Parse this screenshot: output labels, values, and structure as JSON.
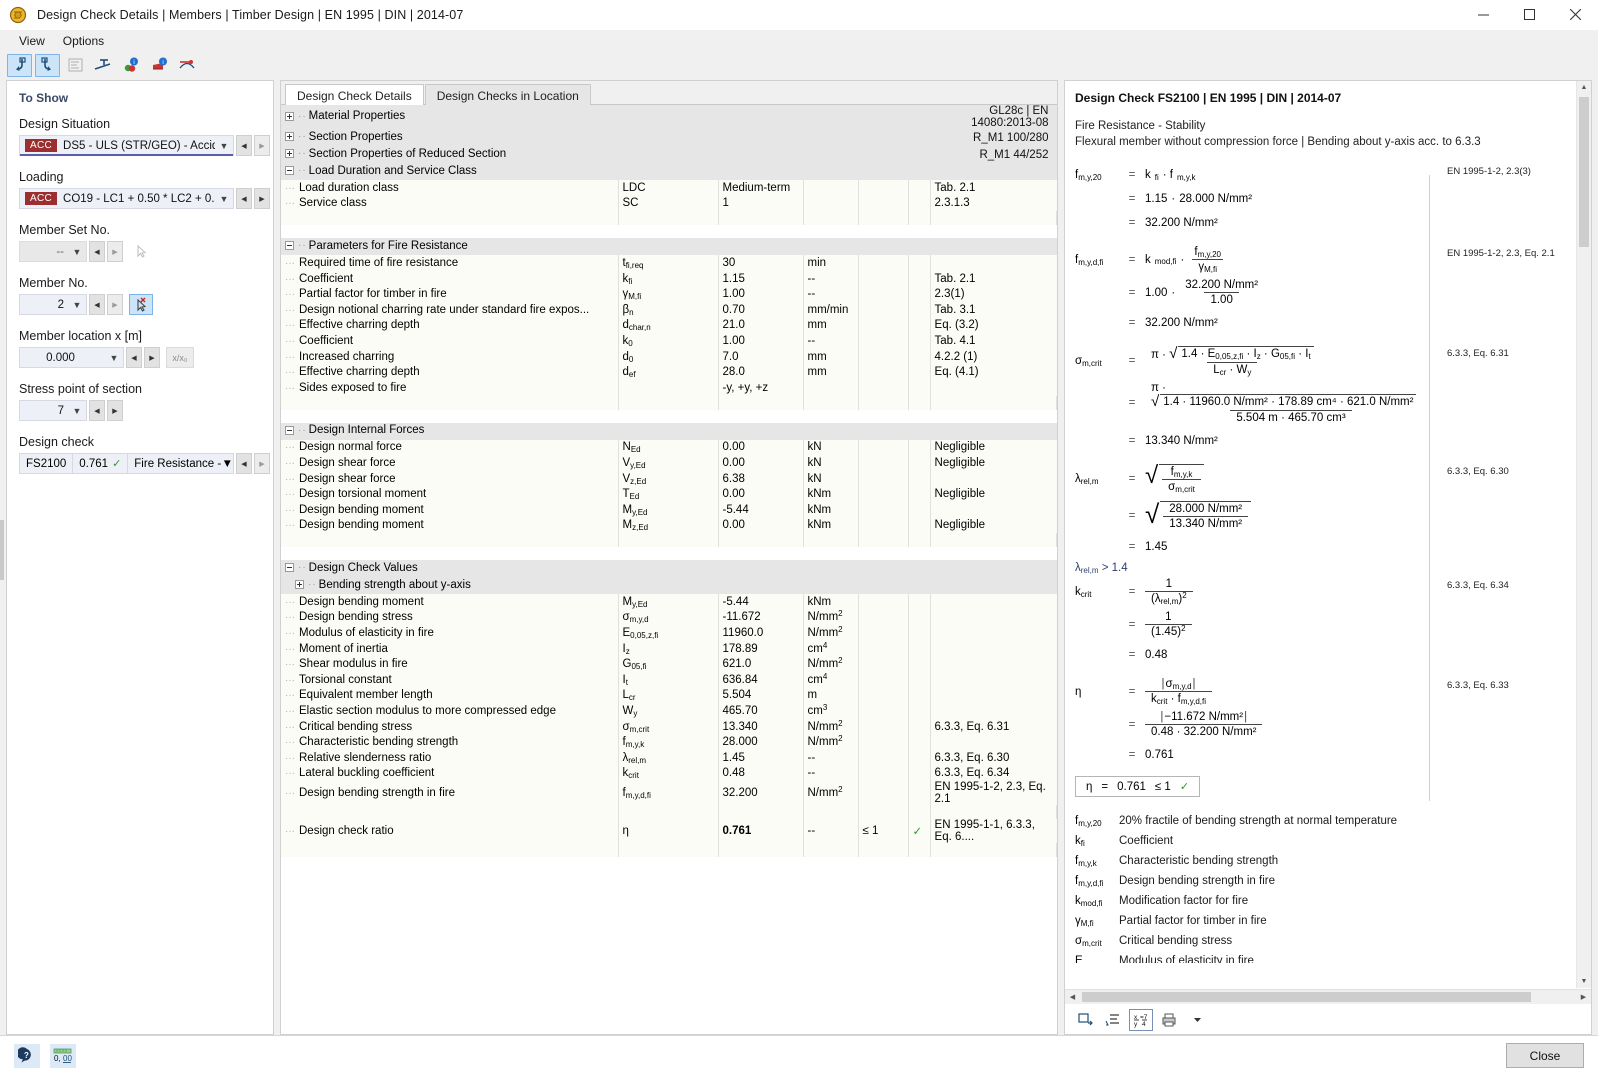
{
  "window": {
    "title": "Design Check Details | Members | Timber Design | EN 1995 | DIN | 2014-07",
    "minimize": "─",
    "maximize": "☐",
    "close": "✕"
  },
  "menubar": {
    "items": [
      "View",
      "Options"
    ]
  },
  "toolbar": {
    "buttons": [
      "navigate-back-icon",
      "navigate-forward-icon",
      "list-view-icon",
      "member-axis-icon",
      "info-green-icon",
      "info-blue-icon",
      "diagram-icon"
    ]
  },
  "left_panel": {
    "heading": "To Show",
    "design_situation": {
      "label": "Design Situation",
      "tag": "ACC",
      "value": "DS5 - ULS (STR/GEO) - Accident..."
    },
    "loading": {
      "label": "Loading",
      "tag": "ACC",
      "value": "CO19 - LC1 + 0.50 * LC2 + 0.50 ..."
    },
    "member_set_no": {
      "label": "Member Set No.",
      "value": "--"
    },
    "member_no": {
      "label": "Member No.",
      "value": "2"
    },
    "member_location": {
      "label": "Member location x [m]",
      "value": "0.000",
      "ratio_button": "x/x₀"
    },
    "stress_point": {
      "label": "Stress point of section",
      "value": "7"
    },
    "design_check": {
      "label": "Design check",
      "id": "FS2100",
      "ratio": "0.761",
      "name": "Fire Resistance - ..."
    }
  },
  "center_panel": {
    "tabs": [
      {
        "label": "Design Check Details",
        "active": true
      },
      {
        "label": "Design Checks in Location",
        "active": false
      }
    ],
    "collapsed_groups": [
      {
        "name": "Material Properties",
        "value": "GL28c | EN 14080:2013-08"
      },
      {
        "name": "Section Properties",
        "value": "R_M1 100/280"
      },
      {
        "name": "Section Properties of Reduced Section",
        "value": "R_M1 44/252"
      }
    ],
    "groups": [
      {
        "name": "Load Duration and Service Class",
        "rows": [
          {
            "name": "Load duration class",
            "symbol": "LDC",
            "value": "Medium-term",
            "value_align": "left",
            "unit": "",
            "limit": "",
            "ok": "",
            "ref": "Tab. 2.1"
          },
          {
            "name": "Service class",
            "symbol": "SC",
            "value": "1",
            "value_align": "left",
            "unit": "",
            "limit": "",
            "ok": "",
            "ref": "2.3.1.3"
          }
        ]
      },
      {
        "name": "Parameters for Fire Resistance",
        "rows": [
          {
            "name": "Required time of fire resistance",
            "symbol": "t|fi,req",
            "value": "30",
            "unit": "min",
            "limit": "",
            "ok": "",
            "ref": ""
          },
          {
            "name": "Coefficient",
            "symbol": "k|fi",
            "value": "1.15",
            "unit": "--",
            "limit": "",
            "ok": "",
            "ref": "Tab. 2.1"
          },
          {
            "name": "Partial factor for timber in fire",
            "symbol": "γ|M,fi",
            "value": "1.00",
            "unit": "--",
            "limit": "",
            "ok": "",
            "ref": "2.3(1)"
          },
          {
            "name": "Design notional charring rate under standard fire expos...",
            "symbol": "β|n",
            "value": "0.70",
            "unit": "mm/min",
            "limit": "",
            "ok": "",
            "ref": "Tab. 3.1"
          },
          {
            "name": "Effective charring depth",
            "symbol": "d|char,n",
            "value": "21.0",
            "unit": "mm",
            "limit": "",
            "ok": "",
            "ref": "Eq. (3.2)"
          },
          {
            "name": "Coefficient",
            "symbol": "k|0",
            "value": "1.00",
            "unit": "--",
            "limit": "",
            "ok": "",
            "ref": "Tab. 4.1"
          },
          {
            "name": "Increased charring",
            "symbol": "d|0",
            "value": "7.0",
            "unit": "mm",
            "limit": "",
            "ok": "",
            "ref": "4.2.2 (1)"
          },
          {
            "name": "Effective charring depth",
            "symbol": "d|ef",
            "value": "28.0",
            "unit": "mm",
            "limit": "",
            "ok": "",
            "ref": "Eq. (4.1)"
          },
          {
            "name": "Sides exposed to fire",
            "symbol": "",
            "value": "-y, +y, +z",
            "value_align": "left",
            "unit": "",
            "limit": "",
            "ok": "",
            "ref": ""
          }
        ]
      },
      {
        "name": "Design Internal Forces",
        "rows": [
          {
            "name": "Design normal force",
            "symbol": "N|Ed",
            "value": "0.00",
            "unit": "kN",
            "limit": "",
            "ok": "",
            "ref": "Negligible"
          },
          {
            "name": "Design shear force",
            "symbol": "V|y,Ed",
            "value": "0.00",
            "unit": "kN",
            "limit": "",
            "ok": "",
            "ref": "Negligible"
          },
          {
            "name": "Design shear force",
            "symbol": "V|z,Ed",
            "value": "6.38",
            "unit": "kN",
            "limit": "",
            "ok": "",
            "ref": ""
          },
          {
            "name": "Design torsional moment",
            "symbol": "T|Ed",
            "value": "0.00",
            "unit": "kNm",
            "limit": "",
            "ok": "",
            "ref": "Negligible"
          },
          {
            "name": "Design bending moment",
            "symbol": "M|y,Ed",
            "value": "-5.44",
            "unit": "kNm",
            "limit": "",
            "ok": "",
            "ref": ""
          },
          {
            "name": "Design bending moment",
            "symbol": "M|z,Ed",
            "value": "0.00",
            "unit": "kNm",
            "limit": "",
            "ok": "",
            "ref": "Negligible"
          }
        ]
      },
      {
        "name": "Design Check Values",
        "subgroup": "Bending strength about y-axis",
        "rows": [
          {
            "name": "Design bending moment",
            "symbol": "M|y,Ed",
            "value": "-5.44",
            "unit": "kNm",
            "limit": "",
            "ok": "",
            "ref": ""
          },
          {
            "name": "Design bending stress",
            "symbol": "σ|m,y,d",
            "value": "-11.672",
            "unit": "N/mm^2",
            "limit": "",
            "ok": "",
            "ref": ""
          },
          {
            "name": "Modulus of elasticity in fire",
            "symbol": "E|0,05,z,fi",
            "value": "11960.0",
            "unit": "N/mm^2",
            "limit": "",
            "ok": "",
            "ref": ""
          },
          {
            "name": "Moment of inertia",
            "symbol": "I|z",
            "value": "178.89",
            "unit": "cm^4",
            "limit": "",
            "ok": "",
            "ref": ""
          },
          {
            "name": "Shear modulus in fire",
            "symbol": "G|05,fi",
            "value": "621.0",
            "unit": "N/mm^2",
            "limit": "",
            "ok": "",
            "ref": ""
          },
          {
            "name": "Torsional constant",
            "symbol": "I|t",
            "value": "636.84",
            "unit": "cm^4",
            "limit": "",
            "ok": "",
            "ref": ""
          },
          {
            "name": "Equivalent member length",
            "symbol": "L|cr",
            "value": "5.504",
            "unit": "m",
            "limit": "",
            "ok": "",
            "ref": ""
          },
          {
            "name": "Elastic section modulus to more compressed edge",
            "symbol": "W|y",
            "value": "465.70",
            "unit": "cm^3",
            "limit": "",
            "ok": "",
            "ref": ""
          },
          {
            "name": "Critical bending stress",
            "symbol": "σ|m,crit",
            "value": "13.340",
            "unit": "N/mm^2",
            "limit": "",
            "ok": "",
            "ref": "6.3.3, Eq. 6.31"
          },
          {
            "name": "Characteristic bending strength",
            "symbol": "f|m,y,k",
            "value": "28.000",
            "unit": "N/mm^2",
            "limit": "",
            "ok": "",
            "ref": ""
          },
          {
            "name": "Relative slenderness ratio",
            "symbol": "λ|rel,m",
            "value": "1.45",
            "unit": "--",
            "limit": "",
            "ok": "",
            "ref": "6.3.3, Eq. 6.30"
          },
          {
            "name": "Lateral buckling coefficient",
            "symbol": "k|crit",
            "value": "0.48",
            "unit": "--",
            "limit": "",
            "ok": "",
            "ref": "6.3.3, Eq. 6.34"
          },
          {
            "name": "Design bending strength in fire",
            "symbol": "f|m,y,d,fi",
            "value": "32.200",
            "unit": "N/mm^2",
            "limit": "",
            "ok": "",
            "ref": "EN 1995-1-2, 2.3, Eq. 2.1"
          }
        ],
        "final_row": {
          "name": "Design check ratio",
          "symbol": "η",
          "value": "0.761",
          "unit": "--",
          "limit": "≤ 1",
          "ok": "✓",
          "ref": "EN 1995-1-1, 6.3.3, Eq. 6...."
        }
      }
    ]
  },
  "right_panel": {
    "title": "Design Check FS2100 | EN 1995 | DIN | 2014-07",
    "subtitle1": "Fire Resistance - Stability",
    "subtitle2": "Flexural member without compression force | Bending about y-axis acc. to 6.3.3",
    "equations": [
      {
        "id": "fmy20",
        "ref": "EN 1995-1-2, 2.3(3)"
      },
      {
        "id": "fmydfi",
        "ref": "EN 1995-1-2, 2.3, Eq. 2.1"
      },
      {
        "id": "sigmacrit",
        "ref": "6.3.3, Eq. 6.31"
      },
      {
        "id": "lambdarel",
        "ref": "6.3.3, Eq. 6.30"
      },
      {
        "id": "kcrit",
        "ref": "6.3.3, Eq. 6.34"
      },
      {
        "id": "eta",
        "ref": "6.3.3, Eq. 6.33"
      }
    ],
    "values": {
      "kfi": "1.15",
      "fmyk": "28.000 N/mm²",
      "fmy20": "32.200 N/mm²",
      "kmodfi": "1.00",
      "gammaMfi": "1.00",
      "fmydfi": "32.200 N/mm²",
      "factor14": "1.4",
      "E005zfi": "11960.0 N/mm²",
      "Iz": "178.89 cm⁴",
      "G05fi": "621.0 N/mm²",
      "Lcr": "5.504 m",
      "Wy": "465.70 cm³",
      "sigmamcrit": "13.340 N/mm²",
      "lambdarelm": "1.45",
      "lambda_note": "λ",
      "lambda_note_sub": "rel,m",
      "lambda_note_rest": " > 1.4",
      "kcrit": "0.48",
      "sigmamyd": "−11.672 N/mm²",
      "eta": "0.761"
    },
    "result_box": {
      "symbol": "η",
      "eq": "=",
      "value": "0.761",
      "limit": "≤ 1",
      "check": "✓"
    },
    "legend": [
      {
        "symbol": "f|m,y,20",
        "text": "20% fractile of bending strength at normal temperature"
      },
      {
        "symbol": "k|fi",
        "text": "Coefficient"
      },
      {
        "symbol": "f|m,y,k",
        "text": "Characteristic bending strength"
      },
      {
        "symbol": "f|m,y,d,fi",
        "text": "Design bending strength in fire"
      },
      {
        "symbol": "k|mod,fi",
        "text": "Modification factor for fire"
      },
      {
        "symbol": "γ|M,fi",
        "text": "Partial factor for timber in fire"
      },
      {
        "symbol": "σ|m,crit",
        "text": "Critical bending stress"
      },
      {
        "symbol": "E|",
        "text": "Modulus of elasticity in fire"
      }
    ],
    "toolbar_buttons": [
      "export-icon",
      "list-icon",
      "formula-icon",
      "print-icon",
      "dropdown-icon"
    ]
  },
  "statusbar": {
    "buttons": [
      "help-icon",
      "decimal-places-icon"
    ],
    "close_label": "Close"
  }
}
